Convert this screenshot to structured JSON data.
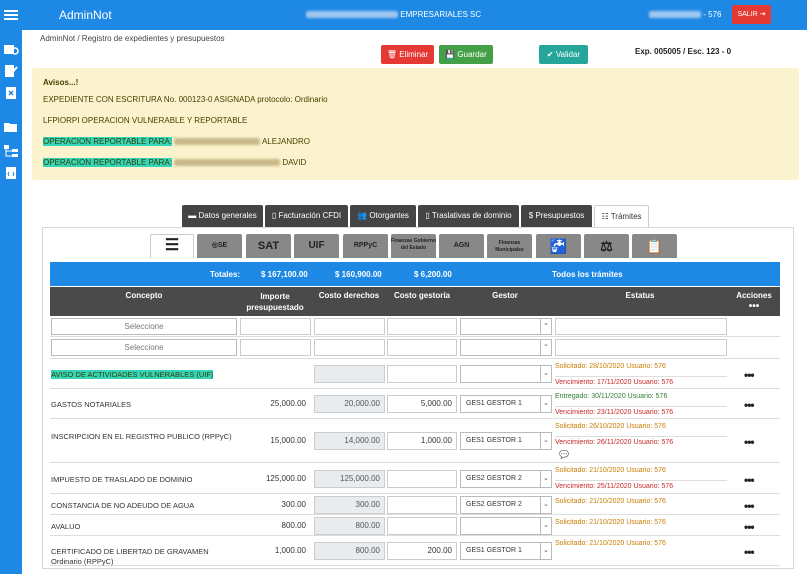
{
  "app": {
    "name": "AdminNot",
    "center_text": "EMPRESARIALES SC",
    "user_suffix": "- 576",
    "exit_label": "SALIR"
  },
  "breadcrumb": "AdminNot / Registro de expedientes y presupuestos",
  "actions": {
    "delete": "Eliminar",
    "save": "Guardar",
    "validate": "Validar"
  },
  "exp_number": "Exp. 005005 / Esc. 123 - 0",
  "notices": {
    "title": "Avisos...!",
    "line1": "EXPEDIENTE CON ESCRITURA No. 000123-0 ASIGNADA protocolo: Ordinario",
    "line2": "LFPIORPI OPERACION VULNERABLE Y REPORTABLE",
    "tag": "OPERACION REPORTABLE PARA:",
    "name1": "ALEJANDRO",
    "name2": "DAVID"
  },
  "tabs": [
    "Datos generales",
    "Facturación CFDI",
    "Otorgantes",
    "Traslativas de dominio",
    "Presupuestos",
    "Trámites"
  ],
  "inner_tabs": [
    "SE",
    "SAT",
    "UIF",
    "RPPyC",
    "Finanzas Gobierno del Estado",
    "AGN",
    "Finanzas Municipales"
  ],
  "totals": {
    "label": "Totales:",
    "importe": "$ 167,100.00",
    "derechos": "$ 160,900.00",
    "gestoria": "$ 6,200.00",
    "filter": "Todos los trámites"
  },
  "headers": {
    "concepto": "Concepto",
    "importe": "Importe presupuestado",
    "derechos": "Costo derechos",
    "gestoria": "Costo gestoría",
    "gestor": "Gestor",
    "estatus": "Estatus",
    "acciones": "Acciones"
  },
  "select_placeholder": "Seleccione",
  "rows": [
    {
      "concepto": "AVISO DE ACTIVIDADES VULNERABLES (UIF)",
      "importe": "",
      "derechos": "",
      "gestoria": "",
      "gestor": "",
      "s1": "Solicitado: 28/10/2020 Usuario: 576",
      "s2": "Vencimiento: 17/11/2020 Usuario: 576"
    },
    {
      "concepto": "GASTOS NOTARIALES",
      "importe": "25,000.00",
      "derechos": "20,000.00",
      "gestoria": "5,000.00",
      "gestor": "GES1 GESTOR 1",
      "s1": "Entregado: 30/11/2020 Usuario: 576",
      "s2": "Vencimiento: 23/11/2020 Usuario: 576"
    },
    {
      "concepto": "INSCRIPCION EN EL REGISTRO PUBLICO (RPPyC)",
      "importe": "15,000.00",
      "derechos": "14,000.00",
      "gestoria": "1,000.00",
      "gestor": "GES1 GESTOR 1",
      "s1": "Solicitado: 26/10/2020 Usuario: 576",
      "s2": "Vencimiento: 26/11/2020 Usuario: 576"
    },
    {
      "concepto": "IMPUESTO DE TRASLADO DE DOMINIO",
      "importe": "125,000.00",
      "derechos": "125,000.00",
      "gestoria": "",
      "gestor": "GES2 GESTOR 2",
      "s1": "Solicitado: 21/10/2020 Usuario: 576",
      "s2": "Vencimiento: 25/11/2020 Usuario: 576"
    },
    {
      "concepto": "CONSTANCIA DE NO ADEUDO DE AGUA",
      "importe": "300.00",
      "derechos": "300.00",
      "gestoria": "",
      "gestor": "GES2 GESTOR 2",
      "s1": "Solicitado: 21/10/2020 Usuario: 576",
      "s2": ""
    },
    {
      "concepto": "AVALUO",
      "importe": "800.00",
      "derechos": "800.00",
      "gestoria": "",
      "gestor": "",
      "s1": "Solicitado: 21/10/2020 Usuario: 576",
      "s2": ""
    },
    {
      "concepto": "CERTIFICADO DE LIBERTAD DE GRAVAMEN Ordinario (RPPyC)",
      "importe": "1,000.00",
      "derechos": "800.00",
      "gestoria": "200.00",
      "gestor": "GES1 GESTOR 1",
      "s1": "Solicitado: 21/10/2020 Usuario: 576",
      "s2": ""
    }
  ],
  "colors": {
    "primary": "#1e88e5",
    "danger": "#e53935",
    "success": "#43a047",
    "info": "#26a69a",
    "notice_bg": "#fbf3cd",
    "highlight": "#35d6b8"
  }
}
